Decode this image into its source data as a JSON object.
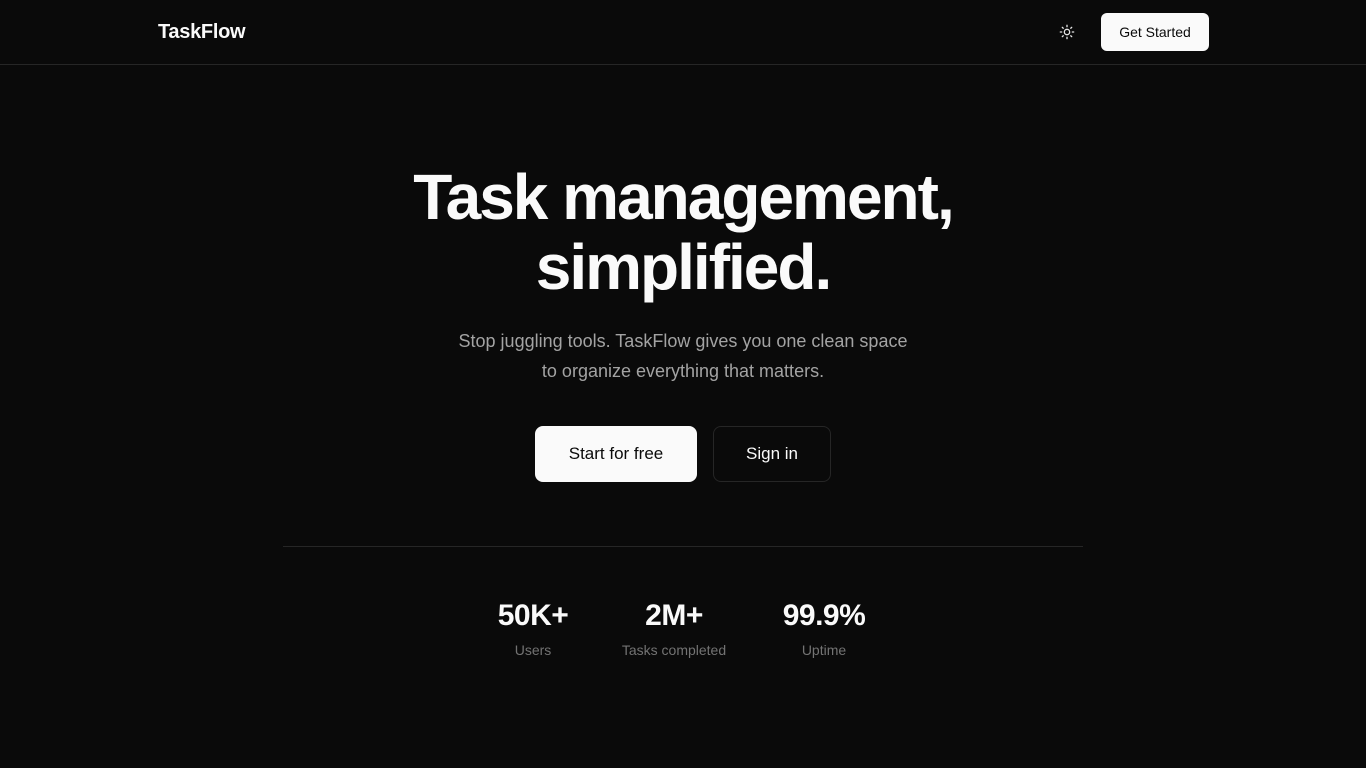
{
  "header": {
    "brand": "TaskFlow",
    "theme_toggle_icon": "sun-icon",
    "cta_label": "Get Started"
  },
  "hero": {
    "title_line1": "Task management,",
    "title_line2": "simplified.",
    "subtitle_line1": "Stop juggling tools. TaskFlow gives you one clean space",
    "subtitle_line2": "to organize everything that matters.",
    "primary_button": "Start for free",
    "secondary_button": "Sign in"
  },
  "stats": [
    {
      "value": "50K+",
      "label": "Users"
    },
    {
      "value": "2M+",
      "label": "Tasks completed"
    },
    {
      "value": "99.9%",
      "label": "Uptime"
    }
  ],
  "colors": {
    "background": "#0a0a0a",
    "foreground": "#fafafa",
    "muted": "#a3a3a3",
    "border": "#262626"
  }
}
